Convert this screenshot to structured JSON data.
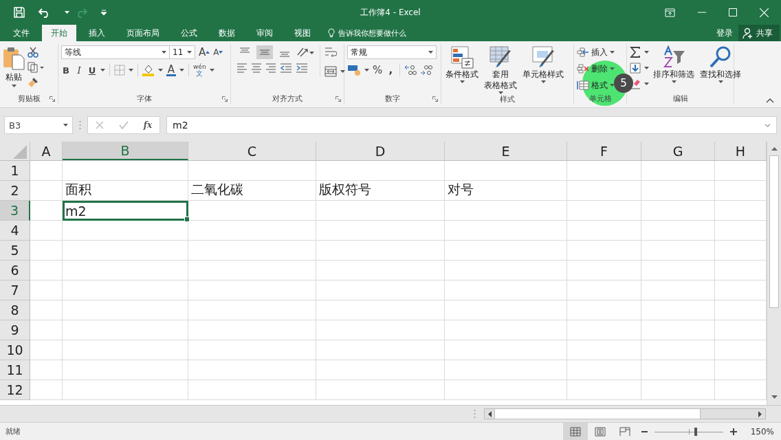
{
  "window": {
    "title": "工作簿4 - Excel"
  },
  "tabs": [
    {
      "label": "文件",
      "selected": false
    },
    {
      "label": "开始",
      "selected": true
    },
    {
      "label": "插入",
      "selected": false
    },
    {
      "label": "页面布局",
      "selected": false
    },
    {
      "label": "公式",
      "selected": false
    },
    {
      "label": "数据",
      "selected": false
    },
    {
      "label": "审阅",
      "selected": false
    },
    {
      "label": "视图",
      "selected": false
    }
  ],
  "tell_me": {
    "text": "告诉我你想要做什么"
  },
  "account": {
    "sign_in": "登录",
    "share": "共享"
  },
  "ribbon": {
    "clipboard": {
      "label": "剪贴板",
      "paste": "粘贴"
    },
    "font": {
      "label": "字体",
      "font_name": "等线",
      "font_size": "11",
      "grow": "A",
      "shrink": "A",
      "styles": [
        {
          "kind": "bold",
          "label": "B"
        },
        {
          "kind": "italic",
          "label": "I"
        },
        {
          "kind": "underline",
          "label": "U"
        }
      ],
      "font_color": "A",
      "phonetic": [
        "wén",
        "文"
      ]
    },
    "alignment": {
      "label": "对齐方式",
      "vertical": [
        {
          "kind": "top",
          "selected": false
        },
        {
          "kind": "middle",
          "selected": true
        },
        {
          "kind": "bottom",
          "selected": false
        }
      ]
    },
    "number": {
      "label": "数字",
      "format": "常规",
      "percent": "%",
      "comma": ","
    },
    "styles": {
      "label": "样式",
      "buttons": [
        {
          "kind": "conditional",
          "lines": [
            "条件格式"
          ]
        },
        {
          "kind": "table",
          "lines": [
            "套用",
            "表格格式"
          ]
        },
        {
          "kind": "cell",
          "lines": [
            "单元格样式"
          ]
        }
      ]
    },
    "cells": {
      "label": "单元格",
      "items": [
        {
          "kind": "insert",
          "label": "插入"
        },
        {
          "kind": "delete",
          "label": "删除"
        },
        {
          "kind": "format",
          "label": "格式"
        }
      ]
    },
    "editing": {
      "label": "编辑",
      "buttons": [
        {
          "kind": "sort",
          "label": "排序和筛选"
        },
        {
          "kind": "find",
          "label": "查找和选择"
        }
      ]
    }
  },
  "step_badge": "5",
  "formula_bar": {
    "name_box": "B3",
    "function_label": "fx",
    "formula": "m2"
  },
  "sheet": {
    "columns": [
      {
        "label": "A",
        "selected": false
      },
      {
        "label": "B",
        "selected": true
      },
      {
        "label": "C",
        "selected": false
      },
      {
        "label": "D",
        "selected": false
      },
      {
        "label": "E",
        "selected": false
      },
      {
        "label": "F",
        "selected": false
      },
      {
        "label": "G",
        "selected": false
      },
      {
        "label": "H",
        "selected": false
      }
    ],
    "rows": [
      {
        "label": "1",
        "selected": false,
        "cells": {}
      },
      {
        "label": "2",
        "selected": false,
        "cells": {
          "B": {
            "text": "面积",
            "active": false
          },
          "C": {
            "text": "二氧化碳",
            "active": false
          },
          "D": {
            "text": "版权符号",
            "active": false
          },
          "E": {
            "text": "对号",
            "active": false
          }
        }
      },
      {
        "label": "3",
        "selected": true,
        "cells": {
          "B": {
            "text": "m2",
            "active": true
          }
        }
      },
      {
        "label": "4",
        "selected": false,
        "cells": {}
      },
      {
        "label": "5",
        "selected": false,
        "cells": {}
      },
      {
        "label": "6",
        "selected": false,
        "cells": {}
      },
      {
        "label": "7",
        "selected": false,
        "cells": {}
      },
      {
        "label": "8",
        "selected": false,
        "cells": {}
      },
      {
        "label": "9",
        "selected": false,
        "cells": {}
      },
      {
        "label": "10",
        "selected": false,
        "cells": {}
      },
      {
        "label": "11",
        "selected": false,
        "cells": {}
      },
      {
        "label": "12",
        "selected": false,
        "cells": {}
      }
    ]
  },
  "status_bar": {
    "text": "就绪",
    "views": [
      {
        "kind": "normal",
        "selected": true
      },
      {
        "kind": "page_layout",
        "selected": false
      },
      {
        "kind": "page_break",
        "selected": false
      }
    ],
    "zoom": {
      "level": 0.6,
      "reading": "150%"
    }
  }
}
